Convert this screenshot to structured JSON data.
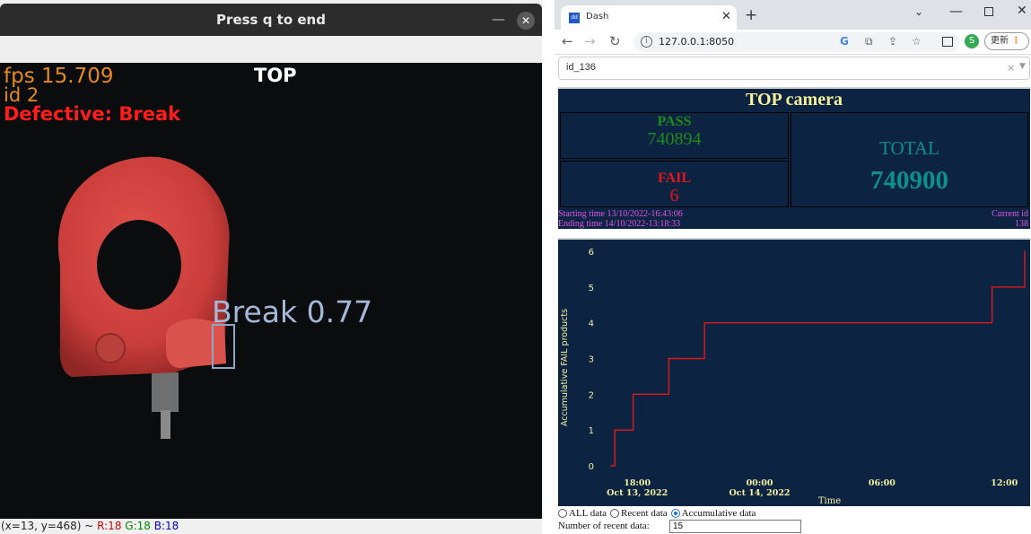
{
  "cv_window": {
    "title": "Press q to end",
    "overlay": {
      "fps": "fps 15.709",
      "id": "id 2",
      "defect": "Defective: Break",
      "camera": "TOP",
      "detection_label": "Break 0.77"
    },
    "status": {
      "coords": "(x=13, y=468) ~ ",
      "r": "R:18",
      "g": "G:18",
      "b": "B:18"
    }
  },
  "browser": {
    "tab_title": "Dash",
    "favicon_text": "dd",
    "url": "127.0.0.1:8050",
    "profile_initial": "S",
    "update_label": "更新",
    "icons": [
      "info-icon",
      "google-icon",
      "translate-icon",
      "share-icon",
      "star-icon",
      "side-panel-icon"
    ]
  },
  "dashboard": {
    "dropdown_value": "id_136",
    "title": "TOP camera",
    "pass_label": "PASS",
    "pass_value": "740894",
    "fail_label": "FAIL",
    "fail_value": "6",
    "total_label": "TOTAL",
    "total_value": "740900",
    "starting_time": "Starting time 13/10/2022-16:43:06",
    "ending_time": "Ending time 14/10/2022-13:18:33",
    "current_id_label": "Current id",
    "current_id_value": "138",
    "radio_options": [
      "ALL data",
      "Recent data",
      "Accumulative data"
    ],
    "radio_selected": "Accumulative data",
    "recent_label": "Number of recent data:",
    "recent_value": "15",
    "colors": {
      "panel_bg": "#0c2342",
      "pass": "#1d8a1d",
      "fail": "#e4141f",
      "total": "#0f8f8c",
      "footer": "#e256e8",
      "title": "#f5f29a",
      "line": "#e01818"
    }
  },
  "chart_data": {
    "type": "line",
    "line_shape": "step",
    "title": "",
    "xlabel": "Time",
    "ylabel": "Accumulative FAIL products",
    "x_ticks": [
      "18:00\nOct 13, 2022",
      "00:00\nOct 14, 2022",
      "06:00",
      "12:00"
    ],
    "x_tick_hours": [
      18,
      24,
      30,
      36
    ],
    "xlim_hours": [
      16.1,
      37
    ],
    "ylim": [
      0,
      6
    ],
    "y_ticks": [
      0,
      1,
      2,
      3,
      4,
      5,
      6
    ],
    "series": [
      {
        "x_hours": [
          16.72,
          16.9,
          17.8,
          19.55,
          21.3,
          35.4,
          37.0
        ],
        "y": [
          0,
          1,
          2,
          3,
          4,
          5,
          6
        ]
      }
    ],
    "grid": false
  }
}
